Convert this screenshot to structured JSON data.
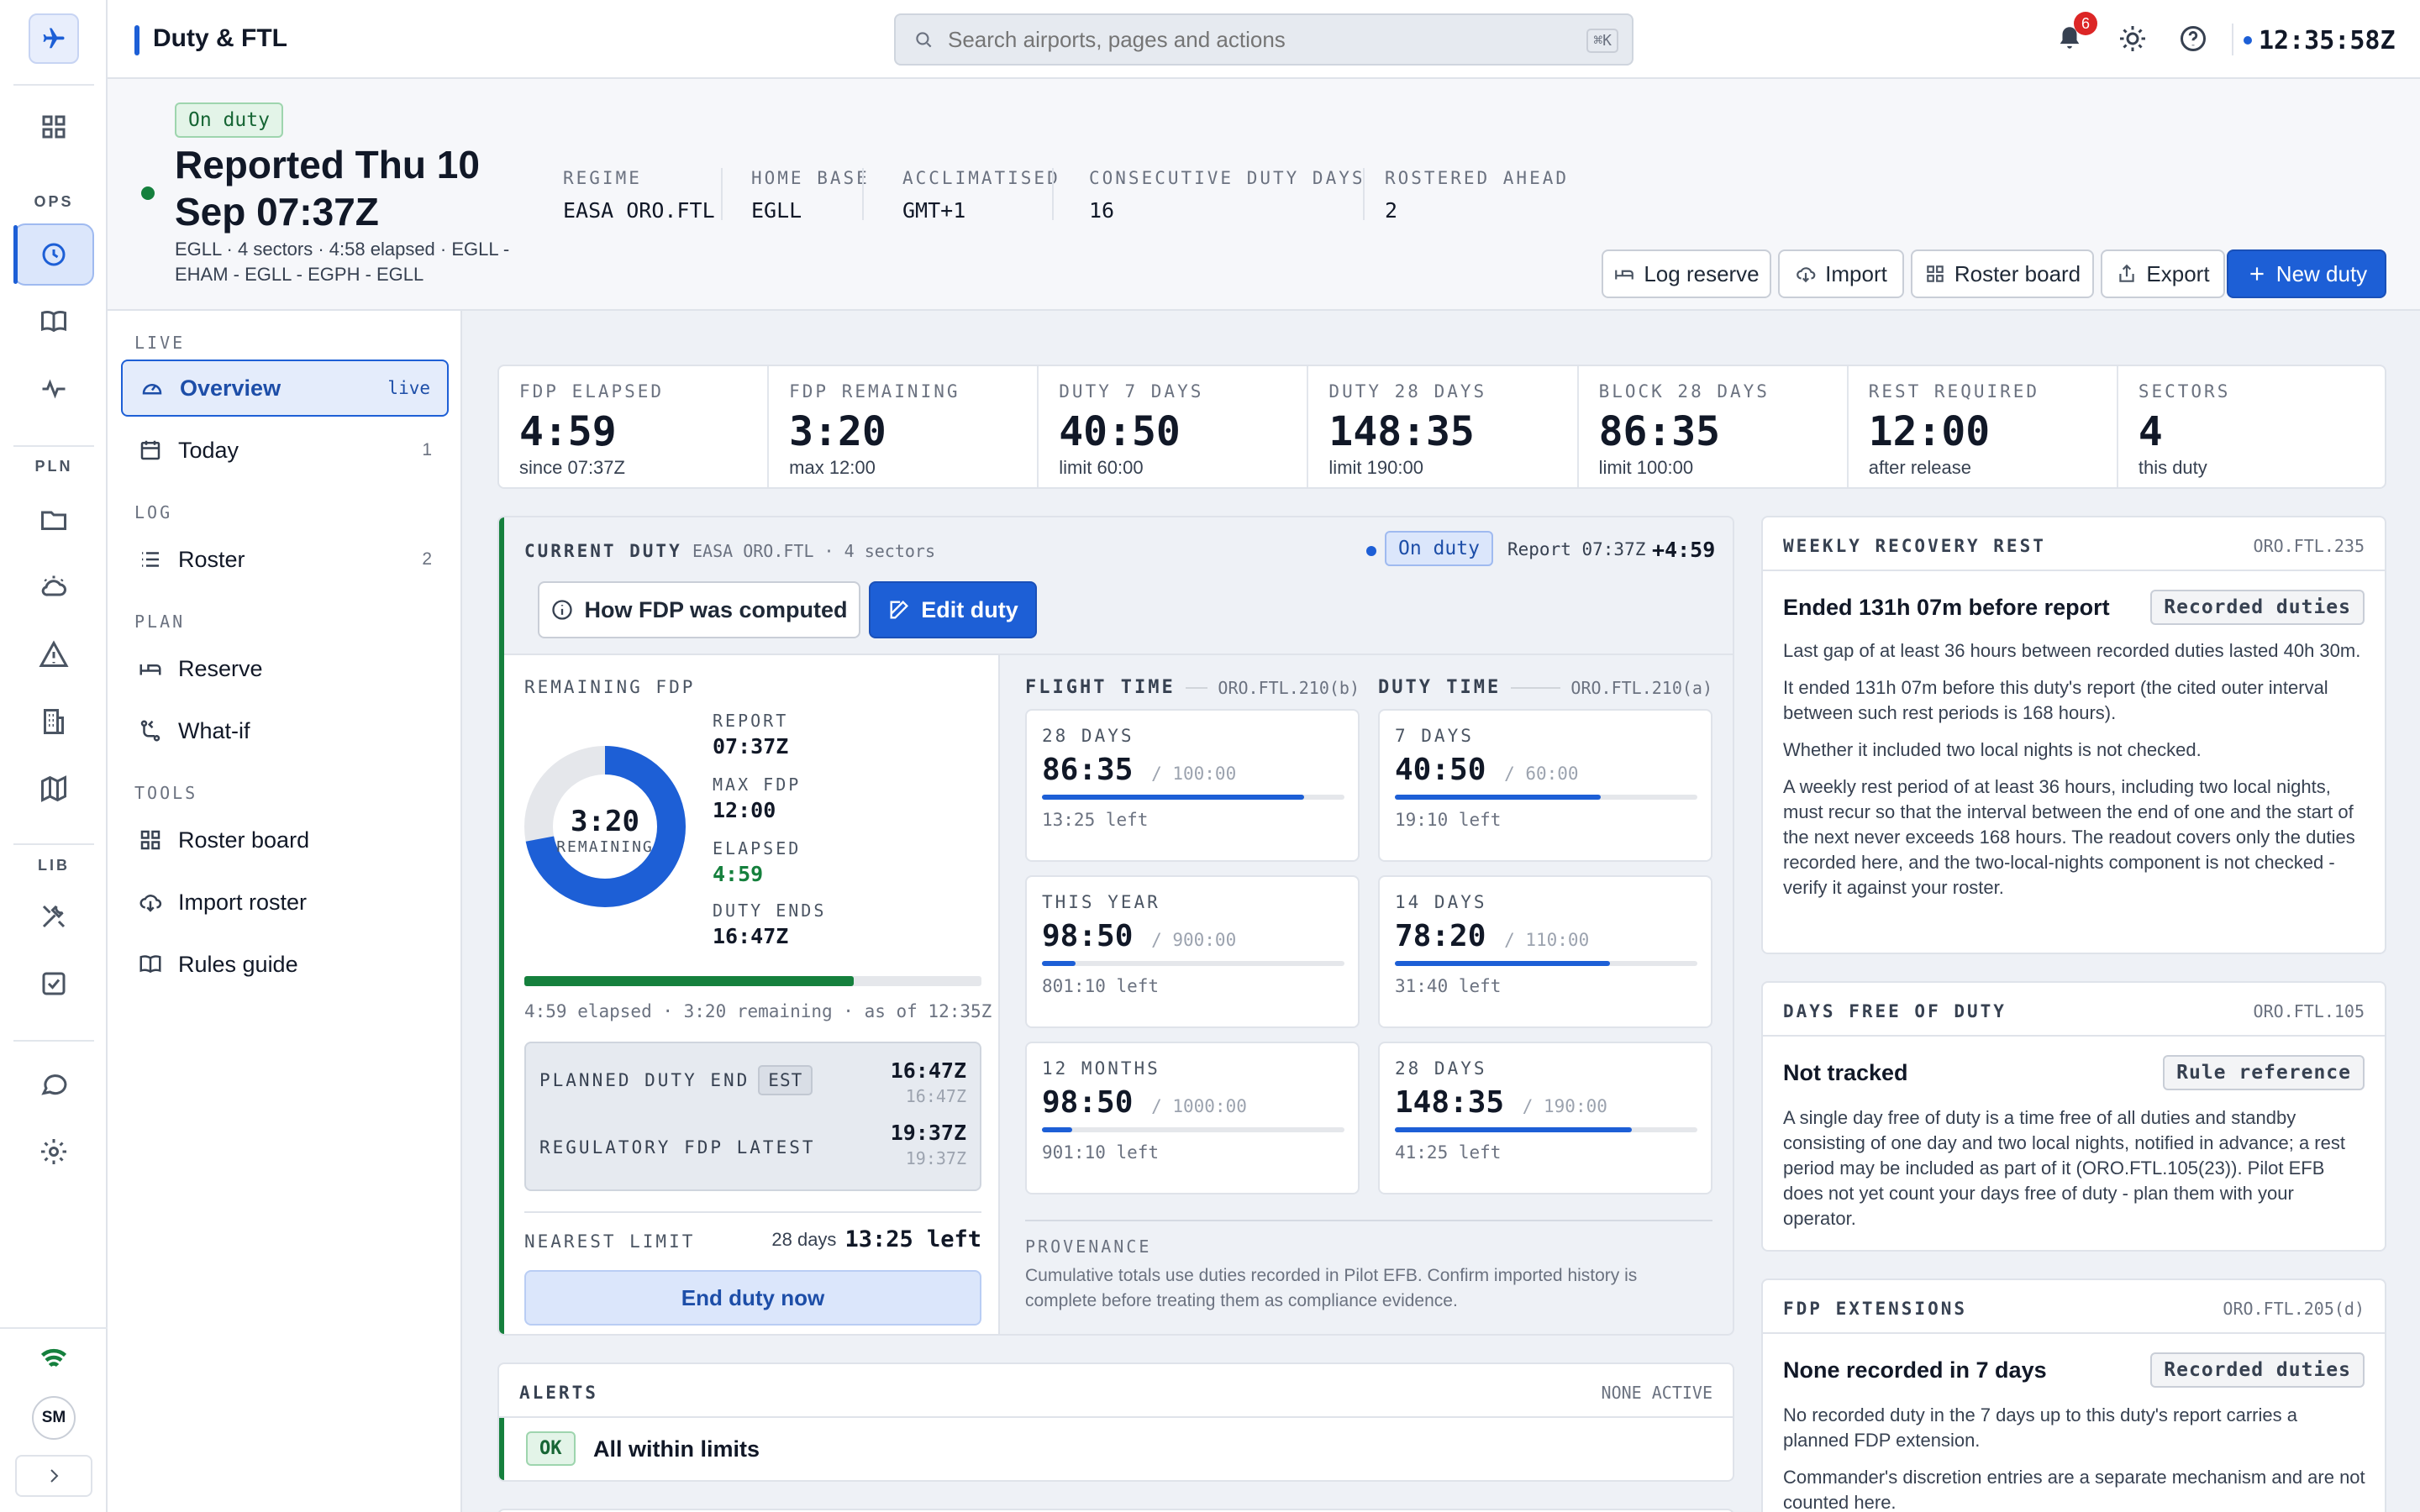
{
  "app": {
    "title": "Duty & FTL",
    "clock": "12:35:58Z",
    "notifications": "6"
  },
  "search": {
    "placeholder": "Search airports, pages and actions",
    "shortcut": "⌘K"
  },
  "rail": {
    "sections": [
      "OPS",
      "PLN",
      "LIB"
    ],
    "avatar": "SM"
  },
  "header": {
    "status": "On duty",
    "title_line1": "Reported Thu 10",
    "title_line2": "Sep 07:37Z",
    "sub_line1": "EGLL · 4 sectors · 4:58 elapsed · EGLL -",
    "sub_line2": "EHAM - EGLL - EGPH - EGLL",
    "meta": [
      {
        "label": "REGIME",
        "value": "EASA ORO.FTL"
      },
      {
        "label": "HOME BASE",
        "value": "EGLL"
      },
      {
        "label": "ACCLIMATISED",
        "value": "GMT+1"
      },
      {
        "label": "CONSECUTIVE DUTY DAYS",
        "value": "16"
      },
      {
        "label": "ROSTERED AHEAD",
        "value": "2"
      }
    ],
    "buttons": {
      "log_reserve": "Log reserve",
      "import": "Import",
      "roster_board": "Roster board",
      "export": "Export",
      "new_duty": "New duty"
    }
  },
  "sidebar": {
    "sections": {
      "live": "LIVE",
      "log": "LOG",
      "plan": "PLAN",
      "tools": "TOOLS"
    },
    "items": {
      "overview": {
        "label": "Overview",
        "tag": "live"
      },
      "today": {
        "label": "Today",
        "count": "1"
      },
      "roster": {
        "label": "Roster",
        "count": "2"
      },
      "reserve": {
        "label": "Reserve"
      },
      "whatif": {
        "label": "What-if"
      },
      "roster_board": {
        "label": "Roster board"
      },
      "import_roster": {
        "label": "Import roster"
      },
      "rules_guide": {
        "label": "Rules guide"
      }
    }
  },
  "stats": [
    {
      "label": "FDP ELAPSED",
      "value": "4:59",
      "sub": "since 07:37Z"
    },
    {
      "label": "FDP REMAINING",
      "value": "3:20",
      "sub": "max 12:00"
    },
    {
      "label": "DUTY 7 DAYS",
      "value": "40:50",
      "sub": "limit 60:00"
    },
    {
      "label": "DUTY 28 DAYS",
      "value": "148:35",
      "sub": "limit 190:00"
    },
    {
      "label": "BLOCK 28 DAYS",
      "value": "86:35",
      "sub": "limit 100:00"
    },
    {
      "label": "REST REQUIRED",
      "value": "12:00",
      "sub": "after release"
    },
    {
      "label": "SECTORS",
      "value": "4",
      "sub": "this duty"
    }
  ],
  "current_duty": {
    "title": "CURRENT DUTY",
    "regime": "EASA ORO.FTL · 4 sectors",
    "status": "On duty",
    "report": "Report 07:37Z",
    "delta": "+4:59",
    "btn_how": "How FDP was computed",
    "btn_edit": "Edit duty",
    "remaining_title": "REMAINING FDP",
    "donut_value": "3:20",
    "donut_label": "REMAINING",
    "donut_fraction": 0.72,
    "report_lbl": "REPORT",
    "report_val": "07:37Z",
    "max_lbl": "MAX FDP",
    "max_val": "12:00",
    "elapsed_lbl": "ELAPSED",
    "elapsed_val": "4:59",
    "ends_lbl": "DUTY ENDS",
    "ends_val": "16:47Z",
    "progress_fraction": 0.72,
    "progress_text": "4:59 elapsed · 3:20 remaining · as of 12:35Z",
    "planned_lbl": "PLANNED DUTY END",
    "planned_badge": "EST",
    "planned_val": "16:47Z",
    "planned_sub": "16:47Z",
    "reg_lbl": "REGULATORY FDP LATEST",
    "reg_val": "19:37Z",
    "reg_sub": "19:37Z",
    "nearest_lbl": "NEAREST LIMIT",
    "nearest_days": "28 days",
    "nearest_val": "13:25 left",
    "end_btn": "End duty now",
    "flight_title": "FLIGHT TIME",
    "flight_rule": "ORO.FTL.210(b)",
    "duty_title": "DUTY TIME",
    "duty_rule": "ORO.FTL.210(a)",
    "flight_tiles": [
      {
        "label": "28 DAYS",
        "value": "86:35",
        "limit": "/ 100:00",
        "left": "13:25 left",
        "fraction": 0.866
      },
      {
        "label": "THIS YEAR",
        "value": "98:50",
        "limit": "/ 900:00",
        "left": "801:10 left",
        "fraction": 0.11
      },
      {
        "label": "12 MONTHS",
        "value": "98:50",
        "limit": "/ 1000:00",
        "left": "901:10 left",
        "fraction": 0.099
      }
    ],
    "duty_tiles": [
      {
        "label": "7 DAYS",
        "value": "40:50",
        "limit": "/ 60:00",
        "left": "19:10 left",
        "fraction": 0.68
      },
      {
        "label": "14 DAYS",
        "value": "78:20",
        "limit": "/ 110:00",
        "left": "31:40 left",
        "fraction": 0.712
      },
      {
        "label": "28 DAYS",
        "value": "148:35",
        "limit": "/ 190:00",
        "left": "41:25 left",
        "fraction": 0.782
      }
    ],
    "provenance_title": "PROVENANCE",
    "provenance_line1": "Cumulative totals use duties recorded in Pilot EFB. Confirm imported history is",
    "provenance_line2": "complete before treating them as compliance evidence."
  },
  "alerts": {
    "title": "ALERTS",
    "status": "NONE ACTIVE",
    "badge": "OK",
    "text": "All within limits"
  },
  "weekly": {
    "title": "WEEKLY RECOVERY REST",
    "rule": "ORO.FTL.235",
    "heading": "Ended 131h 07m before report",
    "badge": "Recorded duties",
    "p1": "Last gap of at least 36 hours between recorded duties lasted 40h 30m.",
    "p2": "It ended 131h 07m before this duty's report (the cited outer interval between such rest periods is 168 hours).",
    "p3": "Whether it included two local nights is not checked.",
    "p4": "A weekly rest period of at least 36 hours, including two local nights, must recur so that the interval between the end of one and the start of the next never exceeds 168 hours. The readout covers only the duties recorded here, and the two-local-nights component is not checked - verify it against your roster."
  },
  "days_free": {
    "title": "DAYS FREE OF DUTY",
    "rule": "ORO.FTL.105",
    "heading": "Not tracked",
    "badge": "Rule reference",
    "p1": "A single day free of duty is a time free of all duties and standby consisting of one day and two local nights, notified in advance; a rest period may be included as part of it (ORO.FTL.105(23)). Pilot EFB does not yet count your days free of duty - plan them with your operator."
  },
  "fdp_ext": {
    "title": "FDP EXTENSIONS",
    "rule": "ORO.FTL.205(d)",
    "heading": "None recorded in 7 days",
    "badge": "Recorded duties",
    "p1": "No recorded duty in the 7 days up to this duty's report carries a planned FDP extension.",
    "p2": "Commander's discretion entries are a separate mechanism and are not counted here."
  },
  "colors": {
    "accent": "#1d5fd6",
    "green": "#15803d",
    "bg": "#eef1f6"
  }
}
